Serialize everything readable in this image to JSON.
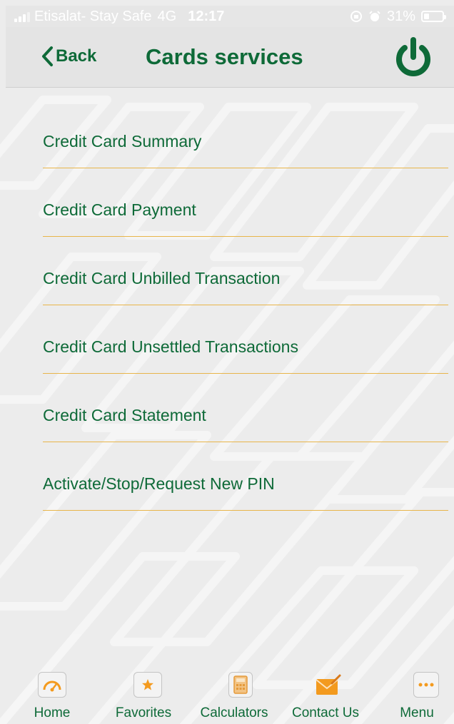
{
  "status_bar": {
    "carrier": "Etisalat- Stay Safe",
    "network": "4G",
    "time": "12:17",
    "battery": "31%",
    "battery_level": 0.31
  },
  "nav": {
    "back_label": "Back",
    "title": "Cards services"
  },
  "menu": {
    "items": [
      {
        "label": "Credit Card Summary"
      },
      {
        "label": "Credit Card Payment"
      },
      {
        "label": "Credit Card Unbilled Transaction"
      },
      {
        "label": "Credit Card Unsettled Transactions"
      },
      {
        "label": "Credit Card Statement"
      },
      {
        "label": "Activate/Stop/Request New PIN"
      }
    ]
  },
  "tabs": [
    {
      "label": "Home",
      "icon": "speedometer-icon"
    },
    {
      "label": "Favorites",
      "icon": "star-icon"
    },
    {
      "label": "Calculators",
      "icon": "calculator-icon"
    },
    {
      "label": "Contact Us",
      "icon": "envelope-icon"
    },
    {
      "label": "Menu",
      "icon": "more-dots-icon"
    }
  ],
  "colors": {
    "brand_green": "#0e6a38",
    "accent_orange": "#f39a1e",
    "divider": "#e8b54a"
  }
}
